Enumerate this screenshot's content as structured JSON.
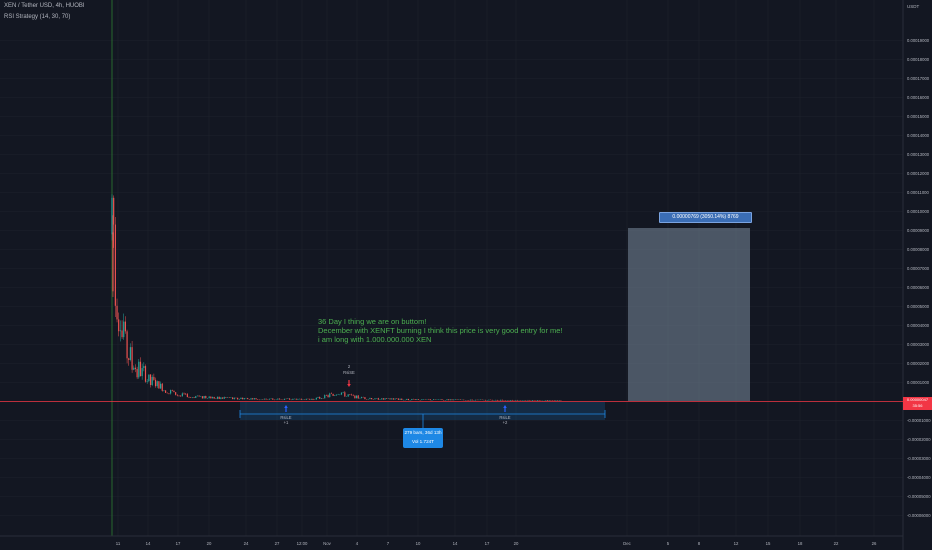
{
  "header": {
    "symbol_line": "XEN / Tether USD, 4h, HUOBI",
    "indicator_line": "RSI Strategy (14, 30, 70)"
  },
  "colors": {
    "background": "#131722",
    "grid": "#1e222d",
    "candle_up": "#26a69a",
    "candle_down": "#ef5350",
    "note_text": "#4caf50",
    "range_box": "#1e88e5",
    "measure_box": "#3a6db5",
    "price_line": "#f23645",
    "cursor_line": "#2e7d32"
  },
  "note": {
    "lines": [
      "36 Day I thing we are on buttom!",
      "December with XENFT burning I think this price is very good entry for me!",
      "i am long with 1.000.000.000 XEN"
    ]
  },
  "measure_label": "0.00000769 (3050.14%) 8769",
  "range_label": {
    "line1": "279 bars, 36d 13h",
    "line2": "Vol 1.724T"
  },
  "current_price": {
    "value": "0.00000047",
    "countdown": "35:56"
  },
  "chart_data": {
    "type": "candlestick",
    "axis_unit": "USDT",
    "x_ticks": [
      "11",
      "14",
      "17",
      "20",
      "24",
      "27",
      "12:00",
      "Nov",
      "4",
      "7",
      "10",
      "14",
      "17",
      "20",
      "Dec",
      "5",
      "8",
      "12",
      "15",
      "18",
      "22",
      "26"
    ],
    "y_ticks": [
      "0.00019000",
      "0.00018000",
      "0.00017000",
      "0.00016000",
      "0.00015000",
      "0.00014000",
      "0.00013000",
      "0.00012000",
      "0.00011000",
      "0.00010000",
      "0.00009000",
      "0.00008000",
      "0.00007000",
      "0.00006000",
      "0.00005000",
      "0.00004000",
      "0.00003000",
      "0.00002000",
      "0.00001000",
      "0.00000000",
      "-0.00001000",
      "-0.00002000",
      "-0.00003000",
      "-0.00004000",
      "-0.00005000",
      "-0.00006000"
    ],
    "ylim": [
      -6.65e-05,
      0.0002
    ],
    "price_path": [
      {
        "t": 0.0,
        "p": 8.8e-05
      },
      {
        "t": 0.35,
        "p": 6.5e-05
      },
      {
        "t": 0.7,
        "p": 4.8e-05
      },
      {
        "t": 1.2,
        "p": 3.4e-05
      },
      {
        "t": 2.0,
        "p": 2.2e-05
      },
      {
        "t": 3.0,
        "p": 1.5e-05
      },
      {
        "t": 4.5,
        "p": 8.5e-06
      },
      {
        "t": 6.0,
        "p": 4.5e-06
      },
      {
        "t": 8.0,
        "p": 2.5e-06
      },
      {
        "t": 11.0,
        "p": 1.8e-06
      },
      {
        "t": 15.0,
        "p": 1.2e-06
      },
      {
        "t": 20.0,
        "p": 1.2e-06
      },
      {
        "t": 21.5,
        "p": 3e-06
      },
      {
        "t": 22.5,
        "p": 4.5e-06
      },
      {
        "t": 23.5,
        "p": 3e-06
      },
      {
        "t": 25.5,
        "p": 1.5e-06
      },
      {
        "t": 30.0,
        "p": 1e-06
      },
      {
        "t": 38.0,
        "p": 7e-07
      },
      {
        "t": 43.0,
        "p": 5e-07
      },
      {
        "t": 44.8,
        "p": 5e-07
      }
    ],
    "signals": [
      {
        "label": "RsiLE",
        "sub": "+1",
        "direction": "long"
      },
      {
        "label": "RsiSE",
        "sub": "2",
        "direction": "short"
      },
      {
        "label": "RsiLE",
        "sub": "+2",
        "direction": "long"
      }
    ],
    "last_price": 4.7e-07,
    "measure": {
      "price_from": 4.7e-07,
      "price_to": 7.69e-06,
      "change_pct": 3050.14,
      "bars": 8769
    },
    "range": {
      "bars": 279,
      "duration": "36d 13h",
      "volume": "1.724T"
    }
  }
}
